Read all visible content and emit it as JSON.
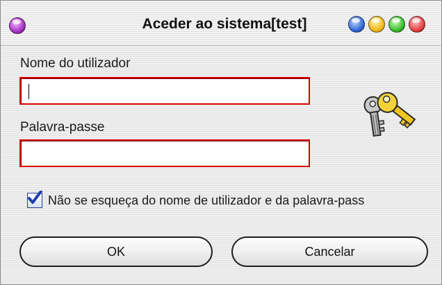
{
  "window": {
    "title": "Aceder ao sistema[test]"
  },
  "form": {
    "username_label": "Nome do utilizador",
    "username_value": "",
    "password_label": "Palavra-passe",
    "password_value": "",
    "remember_label": "Não se esqueça do nome de utilizador e da palavra-pass",
    "remember_checked": true
  },
  "buttons": {
    "ok_label": "OK",
    "cancel_label": "Cancelar"
  },
  "icons": {
    "title_menu": "purple-orb-icon",
    "window_controls": [
      "blue-orb-icon",
      "yellow-orb-icon",
      "green-orb-icon",
      "red-orb-icon"
    ],
    "decoration": "keys-icon",
    "checkbox": "checkmark-icon"
  },
  "colors": {
    "field_border": "#d40000",
    "checkmark": "#1f3fae"
  }
}
